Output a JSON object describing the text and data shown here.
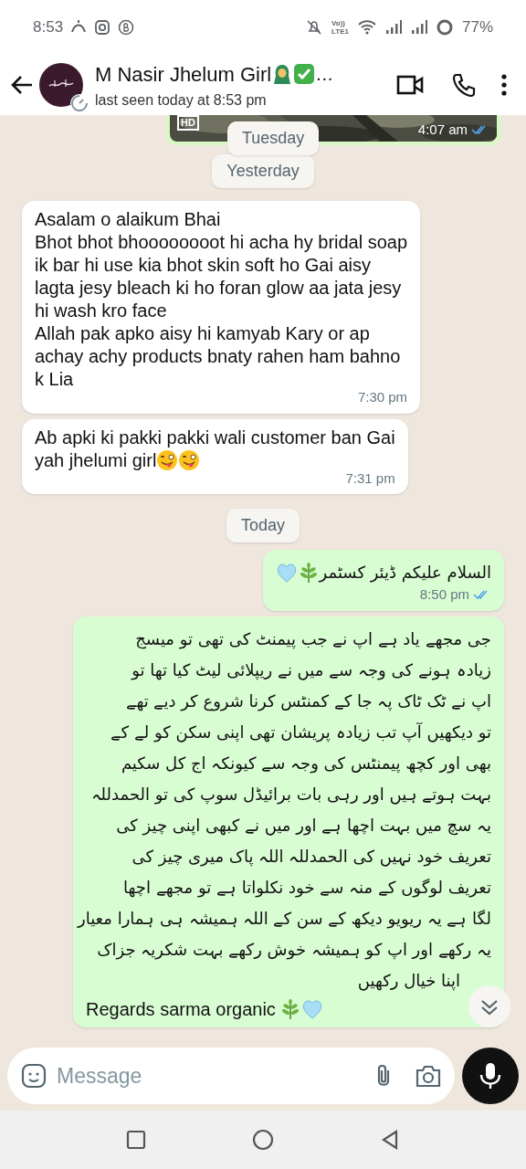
{
  "status_bar": {
    "time": "8:53",
    "volte": "Vo))\nLTE1",
    "battery": "77%"
  },
  "header": {
    "name": "M Nasir Jhelum Girl",
    "name_more": "…",
    "last_seen": "last seen today at 8:53 pm"
  },
  "messages": [
    {
      "kind": "image_out",
      "badge": "HD",
      "time": "4:07 am",
      "read": true
    },
    {
      "kind": "date",
      "text": "Tuesday",
      "floating": true
    },
    {
      "kind": "date",
      "text": "Yesterday",
      "floating": false
    },
    {
      "kind": "text_in",
      "lines": [
        "Asalam o alaikum Bhai",
        "Bhot bhot bhoooooooot hi acha hy bridal soap",
        "ik bar hi use kia bhot skin soft ho Gai aisy",
        "lagta jesy bleach ki ho foran glow aa jata jesy",
        "hi wash kro face",
        "Allah pak apko aisy hi kamyab Kary or ap",
        "achay achy products bnaty rahen ham bahno",
        "k Lia"
      ],
      "time": "7:30 pm"
    },
    {
      "kind": "text_in",
      "lines": [
        "Ab apki ki pakki pakki wali customer ban Gai",
        "yah jhelumi girl"
      ],
      "time": "7:31 pm"
    },
    {
      "kind": "date",
      "text": "Today",
      "floating": false
    },
    {
      "kind": "text_out",
      "rtl": true,
      "lines": [
        "السلام علیکم ڈیئر کسٹمر"
      ],
      "time": "8:50 pm",
      "read": true
    },
    {
      "kind": "text_out",
      "rtl": true,
      "lines": [
        "جی مجھے یاد ہے اپ نے جب پیمنٹ کی تھی تو میسج",
        "زیادہ ہونے کی وجہ سے میں نے ریپلائی لیٹ کیا تھا تو",
        "اپ نے ٹک ٹاک پہ جا کے کمنٹس کرنا شروع کر دیے تھے",
        "تو دیکھیں آپ تب زیادہ پریشان تھی اپنی سکن کو لے کے",
        "بھی اور کچھ پیمنٹس کی وجہ سے کیونکہ اج کل سکیم",
        "بہت ہوتے ہیں اور رہی بات برائیڈل سوپ کی تو الحمدللہ",
        "یہ سچ میں بہت اچھا ہے اور میں نے کبھی اپنی چیز کی",
        "تعریف خود نہیں کی الحمدللہ اللہ پاک میری چیز کی",
        "تعریف لوگوں کے منہ سے خود نکلواتا ہے تو مجھے اچھا",
        "لگا ہے یہ ریویو دیکھ کے سن کے اللہ ہمیشہ ہی ہمارا معیار",
        "یہ رکھے اور اپ کو ہمیشہ خوش رکھے بہت شکریہ جزاک",
        "اپنا خیال رکھیں"
      ],
      "footer": "Regards sarma organic"
    }
  ],
  "composer": {
    "placeholder": "Message"
  }
}
